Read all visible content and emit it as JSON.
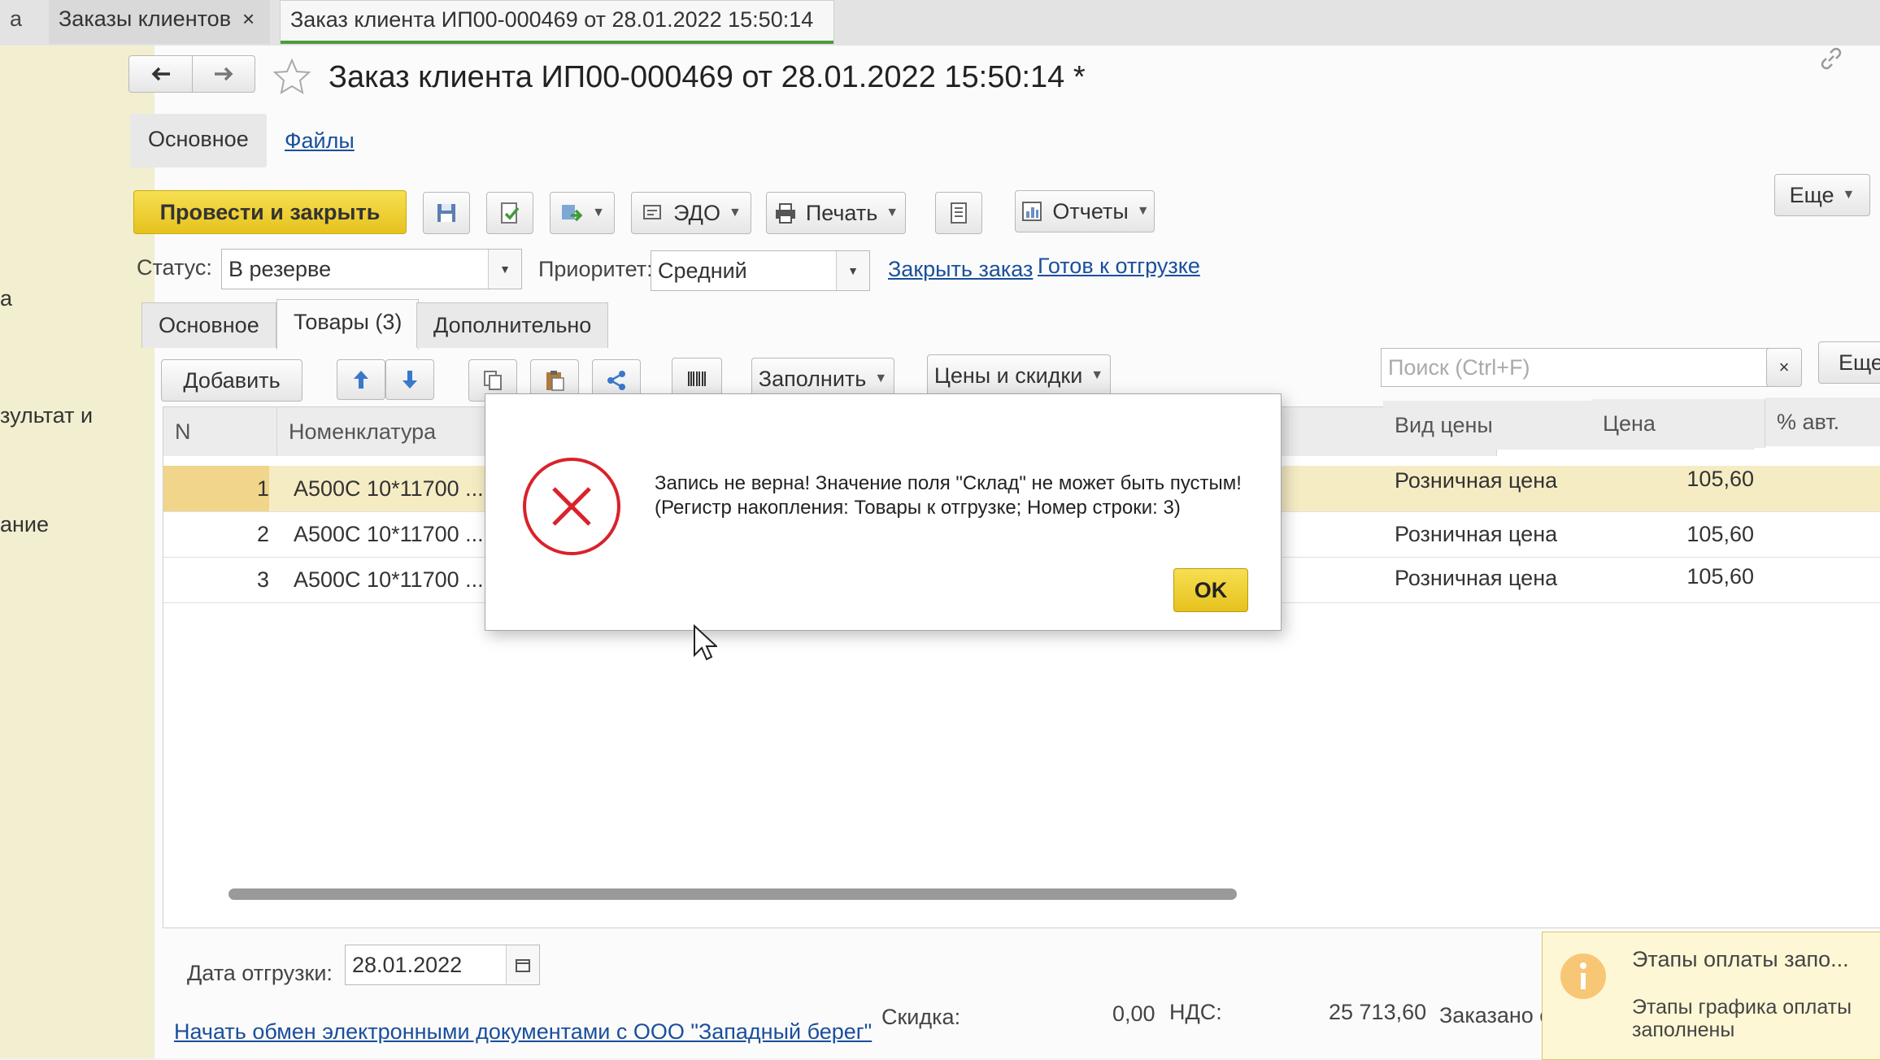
{
  "tabs": {
    "left_stub": "а",
    "orders_tab": "Заказы клиентов",
    "current_tab": "Заказ клиента ИП00-000469 от 28.01.2022 15:50:14 *",
    "close": "×"
  },
  "left_panel": {
    "items": [
      "а",
      "зультат и",
      "ание"
    ]
  },
  "header": {
    "title": "Заказ клиента ИП00-000469 от 28.01.2022 15:50:14 *"
  },
  "section_tabs": {
    "main": "Основное",
    "files": "Файлы"
  },
  "toolbar": {
    "post_close": "Провести и закрыть",
    "edo": "ЭДО",
    "print": "Печать",
    "reports": "Отчеты",
    "more": "Еще"
  },
  "status_row": {
    "status_label": "Статус:",
    "status_value": "В резерве",
    "priority_label": "Приоритет:",
    "priority_value": "Средний",
    "close_order_link": "Закрыть заказ",
    "ready_link": "Готов к отгрузке"
  },
  "form_tabs": [
    "Основное",
    "Товары (3)",
    "Дополнительно"
  ],
  "goods_toolbar": {
    "add": "Добавить",
    "fill": "Заполнить",
    "prices": "Цены и скидки",
    "search_placeholder": "Поиск (Ctrl+F)",
    "search_clear": "×",
    "more": "Еще"
  },
  "table": {
    "headers": {
      "n": "N",
      "nomenclature": "Номенклатура",
      "price_type": "Вид цены",
      "price": "Цена",
      "auto": "% авт."
    },
    "rows": [
      {
        "n": "1",
        "nomenclature": "A500C 10*11700 ...",
        "price_type": "Розничная цена",
        "price": "105,60"
      },
      {
        "n": "2",
        "nomenclature": "A500C 10*11700 ...",
        "price_type": "Розничная цена",
        "price": "105,60"
      },
      {
        "n": "3",
        "nomenclature": "A500C 10*11700 ...",
        "price_type": "Розничная цена",
        "price": "105,60"
      }
    ]
  },
  "footer": {
    "ship_date_label": "Дата отгрузки:",
    "ship_date_value": "28.01.2022",
    "edo_link": "Начать обмен электронными документами с ООО \"Западный берег\"",
    "discount_label": "Скидка:",
    "discount_value": "0,00",
    "vat_label": "НДС:",
    "total_value": "25 713,60",
    "ordered_label": "Заказано с"
  },
  "dialog": {
    "line1": "Запись не верна! Значение поля \"Склад\" не может быть пустым!",
    "line2": "(Регистр накопления: Товары к отгрузке; Номер строки: 3)",
    "ok": "OK"
  },
  "notification": {
    "title": "Этапы оплаты запо...",
    "line1": "Этапы графика оплаты",
    "line2": "заполнены"
  },
  "colors": {
    "accent_yellow": "#f2d12e",
    "error_red": "#d9222a",
    "link_blue": "#1a4f9c",
    "left_panel": "#f1efcf",
    "selected_row": "#f6ecc4"
  }
}
